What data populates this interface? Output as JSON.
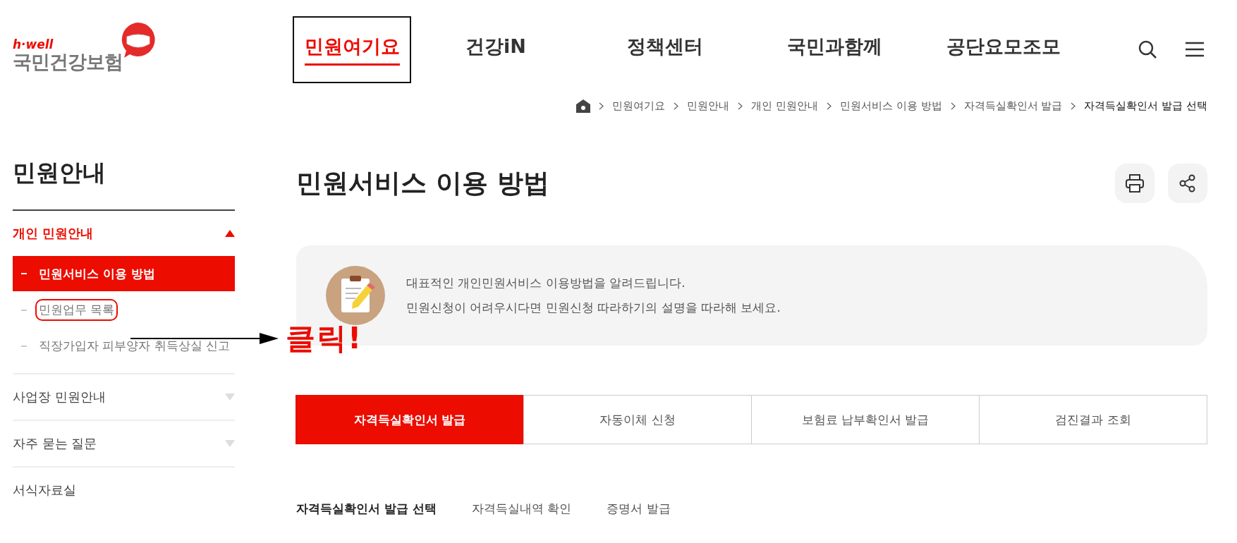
{
  "header": {
    "logo": {
      "tagline": "h·well",
      "name": "국민건강보험"
    },
    "nav": [
      {
        "label": "민원여기요",
        "selected": true,
        "outlined": true
      },
      {
        "label": "건강iN",
        "selected": false,
        "outlined": false
      },
      {
        "label": "정책센터",
        "selected": false,
        "outlined": false
      },
      {
        "label": "국민과함께",
        "selected": false,
        "outlined": false
      },
      {
        "label": "공단요모조모",
        "selected": false,
        "outlined": false
      }
    ]
  },
  "breadcrumb": [
    "민원여기요",
    "민원안내",
    "개인 민원안내",
    "민원서비스 이용 방법",
    "자격득실확인서 발급",
    "자격득실확인서 발급 선택"
  ],
  "sidebar": {
    "title": "민원안내",
    "groups": [
      {
        "label": "개인 민원안내",
        "expanded": true,
        "children": [
          {
            "label": "민원서비스 이용 방법",
            "selected": true,
            "circled": false
          },
          {
            "label": "민원업무 목록",
            "selected": false,
            "circled": true
          },
          {
            "label": "직장가입자 피부양자 취득상실 신고",
            "selected": false,
            "circled": false
          }
        ]
      },
      {
        "label": "사업장 민원안내",
        "expanded": false
      },
      {
        "label": "자주 묻는 질문",
        "expanded": false
      },
      {
        "label": "서식자료실"
      }
    ]
  },
  "annotation": {
    "text": "클릭!"
  },
  "page": {
    "title": "민원서비스 이용 방법",
    "intro": [
      "대표적인 개인민원서비스 이용방법을 알려드립니다.",
      "민원신청이 어려우시다면 민원신청 따라하기의 설명을 따라해 보세요."
    ],
    "tabs": [
      {
        "label": "자격득실확인서 발급",
        "selected": true
      },
      {
        "label": "자동이체 신청",
        "selected": false
      },
      {
        "label": "보험료 납부확인서 발급",
        "selected": false
      },
      {
        "label": "검진결과 조회",
        "selected": false
      }
    ],
    "subtabs": [
      {
        "label": "자격득실확인서 발급 선택",
        "selected": true
      },
      {
        "label": "자격득실내역 확인",
        "selected": false
      },
      {
        "label": "증명서 발급",
        "selected": false
      }
    ]
  }
}
